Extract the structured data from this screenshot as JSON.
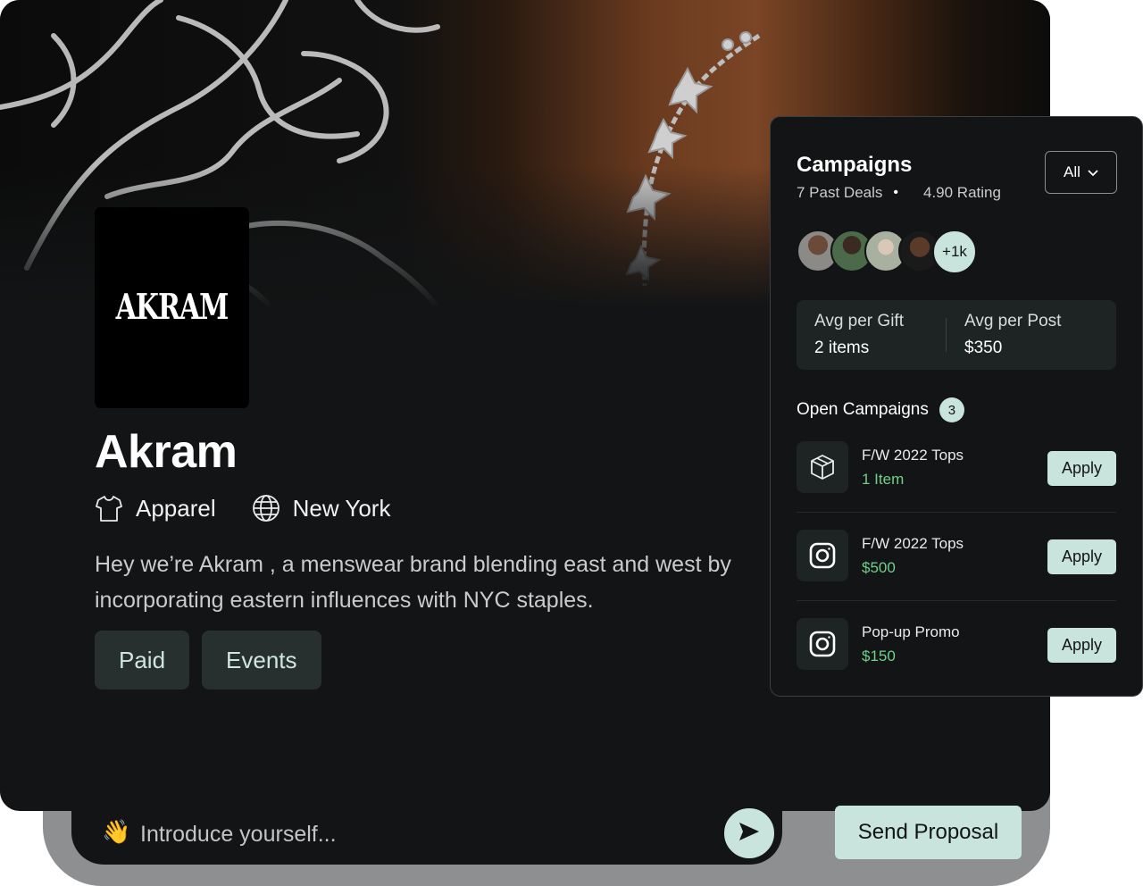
{
  "profile": {
    "logo_text": "AKRAM",
    "name": "Akram",
    "category": "Apparel",
    "location": "New York",
    "description_line1": "Hey we’re Akram , a menswear brand blending east and west by",
    "description_line2": "incorporating eastern influences with NYC staples.",
    "tags": [
      "Paid",
      "Events"
    ]
  },
  "composer": {
    "emoji": "👋",
    "placeholder": "Introduce yourself...",
    "send_proposal_label": "Send Proposal"
  },
  "campaigns": {
    "title": "Campaigns",
    "past_deals": "7 Past Deals",
    "rating": "4.90 Rating",
    "filter_value": "All",
    "more_count": "+1k",
    "avg_gift_label": "Avg per Gift",
    "avg_gift_value": "2 items",
    "avg_post_label": "Avg per Post",
    "avg_post_value": "$350",
    "open_label": "Open Campaigns",
    "open_count": "3",
    "items": [
      {
        "icon": "package-icon",
        "name": "F/W 2022 Tops",
        "detail": "1 Item",
        "action": "Apply"
      },
      {
        "icon": "instagram-icon",
        "name": "F/W 2022 Tops",
        "detail": "$500",
        "action": "Apply"
      },
      {
        "icon": "instagram-icon",
        "name": "Pop-up Promo",
        "detail": "$150",
        "action": "Apply"
      }
    ]
  },
  "colors": {
    "background": "#121415",
    "accent": "#c8e4dc",
    "positive": "#6fd08a",
    "tag_bg": "#27302e"
  }
}
